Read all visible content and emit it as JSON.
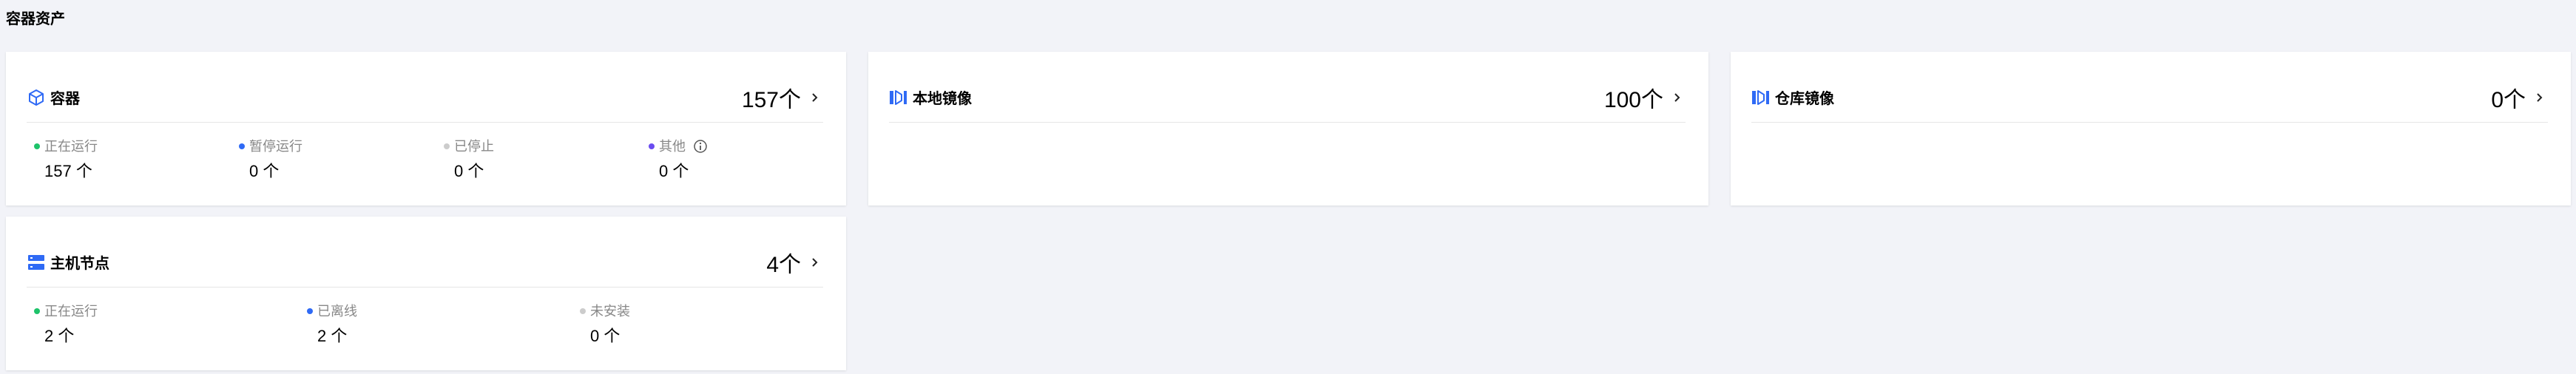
{
  "section_title": "容器资产",
  "colors": {
    "running": "#1ec36a",
    "paused": "#2f6af5",
    "stopped": "#cccccc",
    "other": "#6a4cf0",
    "icon_blue": "#2f6af5"
  },
  "cards": {
    "containers": {
      "icon": "cube-icon",
      "title": "容器",
      "count": "157个",
      "stats": [
        {
          "label": "正在运行",
          "value": "157 个"
        },
        {
          "label": "暂停运行",
          "value": "0 个"
        },
        {
          "label": "已停止",
          "value": "0 个"
        },
        {
          "label": "其他",
          "value": "0 个"
        }
      ]
    },
    "local_images": {
      "icon": "image-layers-icon",
      "title": "本地镜像",
      "count": "100个"
    },
    "repo_images": {
      "icon": "image-layers-icon",
      "title": "仓库镜像",
      "count": "0个"
    },
    "host_nodes": {
      "icon": "server-icon",
      "title": "主机节点",
      "count": "4个",
      "stats": [
        {
          "label": "正在运行",
          "value": "2 个"
        },
        {
          "label": "已离线",
          "value": "2 个"
        },
        {
          "label": "未安装",
          "value": "0 个"
        }
      ]
    }
  }
}
